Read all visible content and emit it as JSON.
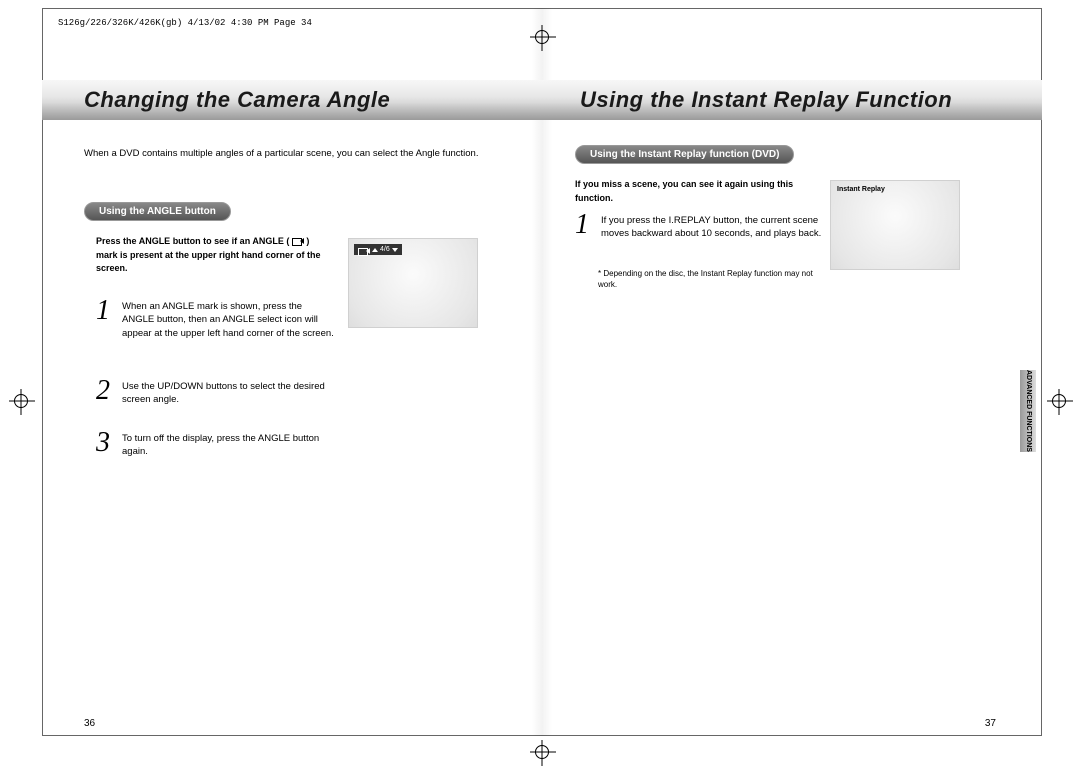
{
  "slugline": "S126g/226/326K/426K(gb)  4/13/02 4:30 PM  Page 34",
  "titles": {
    "left": "Changing the Camera Angle",
    "right": "Using the Instant Replay Function"
  },
  "left": {
    "intro": "When a DVD contains multiple angles of a particular scene, you can select the Angle function.",
    "pill": "Using the ANGLE button",
    "bold_note_pre": "Press the ANGLE button to see if an ANGLE (",
    "bold_note_post": ") mark is present at the upper right hand corner of the screen.",
    "step1": "When an ANGLE mark is shown, press the ANGLE button, then an ANGLE select icon will appear at the upper left hand corner of the screen.",
    "step2": "Use the UP/DOWN buttons to select the desired screen angle.",
    "step3": "To turn off the display, press the ANGLE button again.",
    "angle_indicator": "4/6"
  },
  "right": {
    "pill": "Using the Instant Replay function (DVD)",
    "bold_note": "If you miss a scene, you can see it again using this function.",
    "step1": "If you press the I.REPLAY button, the current scene moves backward about 10 seconds, and plays back.",
    "footnote": "* Depending on the disc, the Instant Replay function may not work.",
    "thumb_label": "Instant Replay"
  },
  "side_tab": "ADVANCED FUNCTIONS",
  "page_numbers": {
    "left": "36",
    "right": "37"
  }
}
